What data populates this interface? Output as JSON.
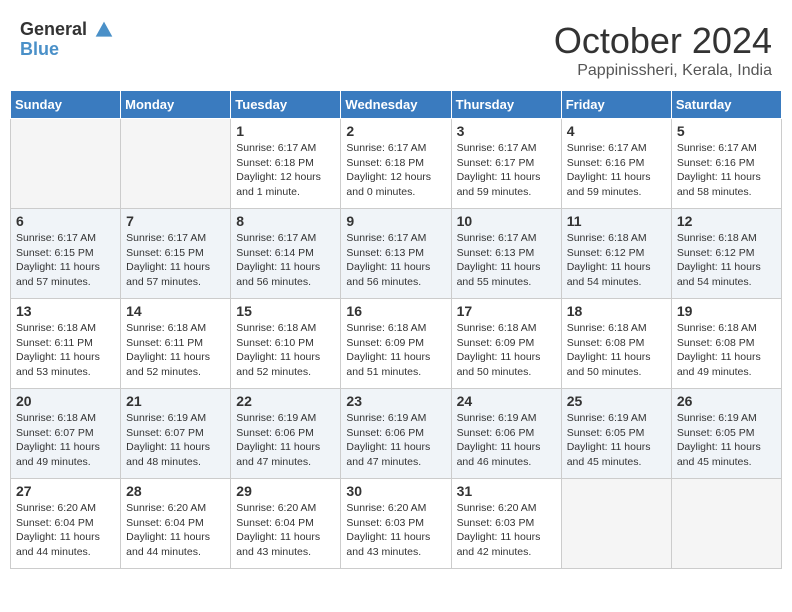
{
  "logo": {
    "line1": "General",
    "line2": "Blue"
  },
  "title": "October 2024",
  "subtitle": "Pappinissheri, Kerala, India",
  "headers": [
    "Sunday",
    "Monday",
    "Tuesday",
    "Wednesday",
    "Thursday",
    "Friday",
    "Saturday"
  ],
  "weeks": [
    [
      {
        "day": "",
        "info": ""
      },
      {
        "day": "",
        "info": ""
      },
      {
        "day": "1",
        "info": "Sunrise: 6:17 AM\nSunset: 6:18 PM\nDaylight: 12 hours\nand 1 minute."
      },
      {
        "day": "2",
        "info": "Sunrise: 6:17 AM\nSunset: 6:18 PM\nDaylight: 12 hours\nand 0 minutes."
      },
      {
        "day": "3",
        "info": "Sunrise: 6:17 AM\nSunset: 6:17 PM\nDaylight: 11 hours\nand 59 minutes."
      },
      {
        "day": "4",
        "info": "Sunrise: 6:17 AM\nSunset: 6:16 PM\nDaylight: 11 hours\nand 59 minutes."
      },
      {
        "day": "5",
        "info": "Sunrise: 6:17 AM\nSunset: 6:16 PM\nDaylight: 11 hours\nand 58 minutes."
      }
    ],
    [
      {
        "day": "6",
        "info": "Sunrise: 6:17 AM\nSunset: 6:15 PM\nDaylight: 11 hours\nand 57 minutes."
      },
      {
        "day": "7",
        "info": "Sunrise: 6:17 AM\nSunset: 6:15 PM\nDaylight: 11 hours\nand 57 minutes."
      },
      {
        "day": "8",
        "info": "Sunrise: 6:17 AM\nSunset: 6:14 PM\nDaylight: 11 hours\nand 56 minutes."
      },
      {
        "day": "9",
        "info": "Sunrise: 6:17 AM\nSunset: 6:13 PM\nDaylight: 11 hours\nand 56 minutes."
      },
      {
        "day": "10",
        "info": "Sunrise: 6:17 AM\nSunset: 6:13 PM\nDaylight: 11 hours\nand 55 minutes."
      },
      {
        "day": "11",
        "info": "Sunrise: 6:18 AM\nSunset: 6:12 PM\nDaylight: 11 hours\nand 54 minutes."
      },
      {
        "day": "12",
        "info": "Sunrise: 6:18 AM\nSunset: 6:12 PM\nDaylight: 11 hours\nand 54 minutes."
      }
    ],
    [
      {
        "day": "13",
        "info": "Sunrise: 6:18 AM\nSunset: 6:11 PM\nDaylight: 11 hours\nand 53 minutes."
      },
      {
        "day": "14",
        "info": "Sunrise: 6:18 AM\nSunset: 6:11 PM\nDaylight: 11 hours\nand 52 minutes."
      },
      {
        "day": "15",
        "info": "Sunrise: 6:18 AM\nSunset: 6:10 PM\nDaylight: 11 hours\nand 52 minutes."
      },
      {
        "day": "16",
        "info": "Sunrise: 6:18 AM\nSunset: 6:09 PM\nDaylight: 11 hours\nand 51 minutes."
      },
      {
        "day": "17",
        "info": "Sunrise: 6:18 AM\nSunset: 6:09 PM\nDaylight: 11 hours\nand 50 minutes."
      },
      {
        "day": "18",
        "info": "Sunrise: 6:18 AM\nSunset: 6:08 PM\nDaylight: 11 hours\nand 50 minutes."
      },
      {
        "day": "19",
        "info": "Sunrise: 6:18 AM\nSunset: 6:08 PM\nDaylight: 11 hours\nand 49 minutes."
      }
    ],
    [
      {
        "day": "20",
        "info": "Sunrise: 6:18 AM\nSunset: 6:07 PM\nDaylight: 11 hours\nand 49 minutes."
      },
      {
        "day": "21",
        "info": "Sunrise: 6:19 AM\nSunset: 6:07 PM\nDaylight: 11 hours\nand 48 minutes."
      },
      {
        "day": "22",
        "info": "Sunrise: 6:19 AM\nSunset: 6:06 PM\nDaylight: 11 hours\nand 47 minutes."
      },
      {
        "day": "23",
        "info": "Sunrise: 6:19 AM\nSunset: 6:06 PM\nDaylight: 11 hours\nand 47 minutes."
      },
      {
        "day": "24",
        "info": "Sunrise: 6:19 AM\nSunset: 6:06 PM\nDaylight: 11 hours\nand 46 minutes."
      },
      {
        "day": "25",
        "info": "Sunrise: 6:19 AM\nSunset: 6:05 PM\nDaylight: 11 hours\nand 45 minutes."
      },
      {
        "day": "26",
        "info": "Sunrise: 6:19 AM\nSunset: 6:05 PM\nDaylight: 11 hours\nand 45 minutes."
      }
    ],
    [
      {
        "day": "27",
        "info": "Sunrise: 6:20 AM\nSunset: 6:04 PM\nDaylight: 11 hours\nand 44 minutes."
      },
      {
        "day": "28",
        "info": "Sunrise: 6:20 AM\nSunset: 6:04 PM\nDaylight: 11 hours\nand 44 minutes."
      },
      {
        "day": "29",
        "info": "Sunrise: 6:20 AM\nSunset: 6:04 PM\nDaylight: 11 hours\nand 43 minutes."
      },
      {
        "day": "30",
        "info": "Sunrise: 6:20 AM\nSunset: 6:03 PM\nDaylight: 11 hours\nand 43 minutes."
      },
      {
        "day": "31",
        "info": "Sunrise: 6:20 AM\nSunset: 6:03 PM\nDaylight: 11 hours\nand 42 minutes."
      },
      {
        "day": "",
        "info": ""
      },
      {
        "day": "",
        "info": ""
      }
    ]
  ]
}
